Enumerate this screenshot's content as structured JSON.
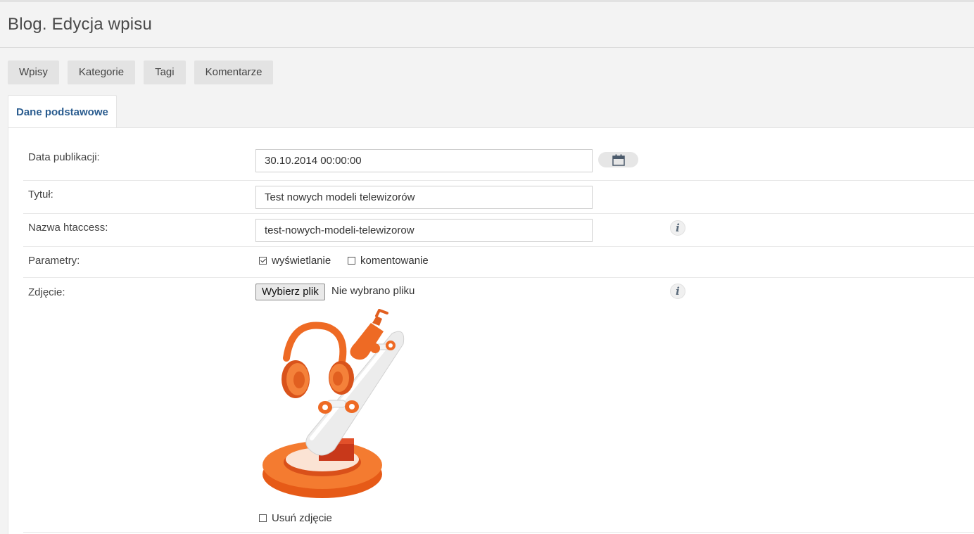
{
  "header": {
    "title": "Blog. Edycja wpisu"
  },
  "subnav": [
    {
      "label": "Wpisy"
    },
    {
      "label": "Kategorie"
    },
    {
      "label": "Tagi"
    },
    {
      "label": "Komentarze"
    }
  ],
  "tabs": [
    {
      "label": "Dane podstawowe",
      "active": true
    }
  ],
  "form": {
    "date": {
      "label": "Data publikacji:",
      "value": "30.10.2014 00:00:00",
      "icon": "calendar-icon"
    },
    "title": {
      "label": "Tytuł:",
      "value": "Test nowych modeli telewizorów"
    },
    "htaccess": {
      "label": "Nazwa htaccess:",
      "value": "test-nowych-modeli-telewizorow",
      "icon": "info-icon"
    },
    "params": {
      "label": "Parametry:",
      "options": [
        {
          "label": "wyświetlanie",
          "checked": true
        },
        {
          "label": "komentowanie",
          "checked": false
        }
      ]
    },
    "photo": {
      "label": "Zdjęcie:",
      "button_label": "Wybierz plik",
      "status": "Nie wybrano pliku",
      "icon": "info-icon",
      "remove_label": "Usuń zdjęcie",
      "remove_checked": false
    }
  },
  "colors": {
    "accent": "#2a5c8f",
    "orange": "#f26522"
  }
}
